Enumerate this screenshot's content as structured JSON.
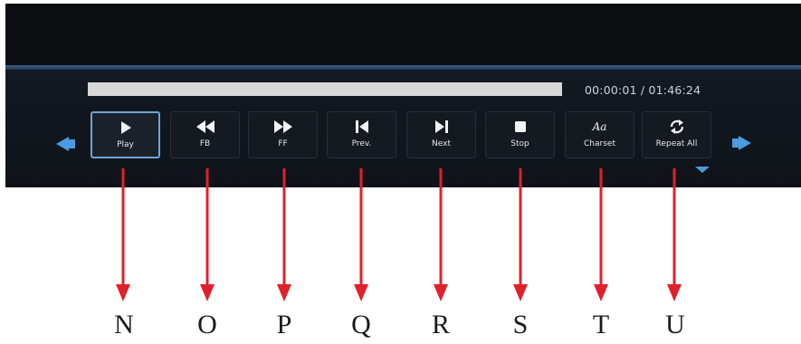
{
  "player": {
    "time_display": "00:00:01  /  01:46:24",
    "controls": [
      {
        "label": "Play",
        "icon": "play-icon"
      },
      {
        "label": "FB",
        "icon": "fast-backward-icon"
      },
      {
        "label": "FF",
        "icon": "fast-forward-icon"
      },
      {
        "label": "Prev.",
        "icon": "previous-icon"
      },
      {
        "label": "Next",
        "icon": "next-icon"
      },
      {
        "label": "Stop",
        "icon": "stop-icon"
      },
      {
        "label": "Charset",
        "icon": "charset-icon",
        "glyph": "Aa"
      },
      {
        "label": "Repeat All",
        "icon": "repeat-icon"
      }
    ],
    "selected_control": "Play"
  },
  "markers": [
    "N",
    "O",
    "P",
    "Q",
    "R",
    "S",
    "T",
    "U"
  ],
  "colors": {
    "screen_bg": "#0c0e12",
    "accent_blue": "#4a9be0",
    "selected_border": "#6fa4d6",
    "pointer_red": "#e0202a"
  }
}
